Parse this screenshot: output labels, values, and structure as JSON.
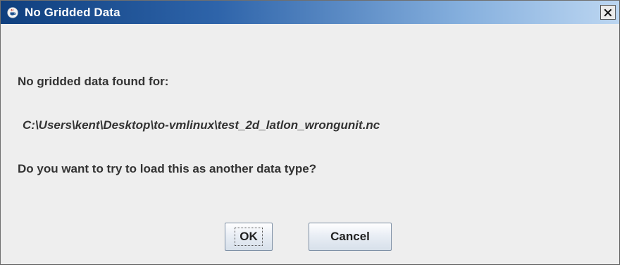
{
  "dialog": {
    "title": "No Gridded Data",
    "app_icon": "java-cup-icon",
    "close_glyph": "close-icon"
  },
  "message": {
    "line1": "No gridded data found for:",
    "path": "C:\\Users\\kent\\Desktop\\to-vmlinux\\test_2d_latlon_wrongunit.nc",
    "line2": "Do you want to try to load this as another data type?"
  },
  "buttons": {
    "ok_label": "OK",
    "cancel_label": "Cancel"
  }
}
